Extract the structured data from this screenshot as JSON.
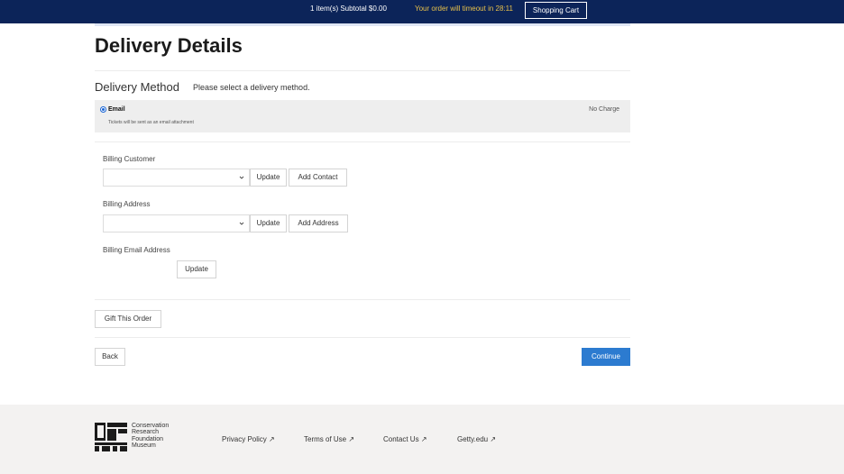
{
  "topbar": {
    "subtotal": "1 item(s) Subtotal $0.00",
    "timeout": "Your order will timeout in 28:11",
    "cart_button": "Shopping Cart"
  },
  "page_title": "Delivery Details",
  "delivery_method": {
    "title": "Delivery Method",
    "hint": "Please select a delivery method.",
    "option": {
      "label": "Email",
      "description": "Tickets will be sent as an email attachment",
      "price": "No Charge",
      "selected": true
    }
  },
  "billing": {
    "customer_label": "Billing Customer",
    "customer_value": "",
    "address_label": "Billing Address",
    "address_value": "",
    "email_label": "Billing Email Address",
    "update_label": "Update",
    "add_contact_label": "Add Contact",
    "add_address_label": "Add Address"
  },
  "gift_button": "Gift This Order",
  "back_button": "Back",
  "continue_button": "Continue",
  "colors": {
    "topbar": "#0c2459",
    "timeout_text": "#e8c14a",
    "continue": "#2c7bd0",
    "footer": "#f3f2f1"
  },
  "footer": {
    "logo_lines": [
      "Conservation",
      "Research",
      "Foundation",
      "Museum"
    ],
    "links": [
      {
        "label": "Privacy Policy",
        "icon": "external-link-icon"
      },
      {
        "label": "Terms of Use",
        "icon": "external-link-icon"
      },
      {
        "label": "Contact Us",
        "icon": "external-link-icon"
      },
      {
        "label": "Getty.edu",
        "icon": "external-link-icon"
      }
    ]
  }
}
